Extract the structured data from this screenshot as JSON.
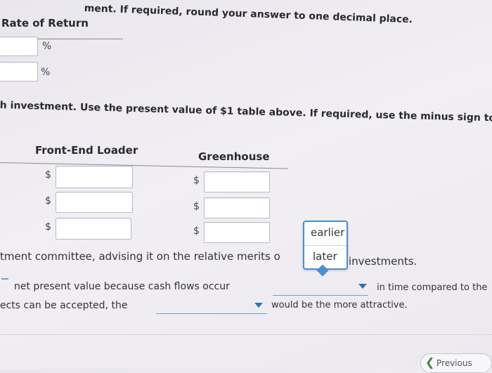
{
  "instructions": {
    "line1": "ment. If required, round your answer to one decimal place.",
    "line2": "h investment. Use the present value of $1 table above. If required, use the minus sign to indic"
  },
  "rate_table": {
    "header": "Rate of Return",
    "rows": [
      {
        "value": "",
        "unit": "%"
      },
      {
        "value": "",
        "unit": "%"
      }
    ]
  },
  "npv_table": {
    "columns": [
      "Front-End Loader",
      "Greenhouse"
    ],
    "currency_symbol": "$",
    "rows": [
      {
        "front_end_loader": "",
        "greenhouse": ""
      },
      {
        "front_end_loader": "",
        "greenhouse": ""
      },
      {
        "front_end_loader": "",
        "greenhouse": ""
      }
    ]
  },
  "memo": {
    "sentence1_start": "tment committee, advising it on the relative merits o",
    "sentence1_end": "investments.",
    "line2_left": "net present value because cash flows occur",
    "line2_right": "in time compared to the",
    "line3_left": "ects can be accepted, the",
    "line3_right": "would be the more attractive."
  },
  "dropdown_popup": {
    "options": [
      "earlier",
      "later"
    ]
  },
  "dropdowns": {
    "timing_selected": "",
    "attractive_selected": ""
  },
  "nav": {
    "previous_label": "Previous"
  },
  "colors": {
    "accent": "#2e73b8",
    "popup_border": "#4a8fd0"
  }
}
